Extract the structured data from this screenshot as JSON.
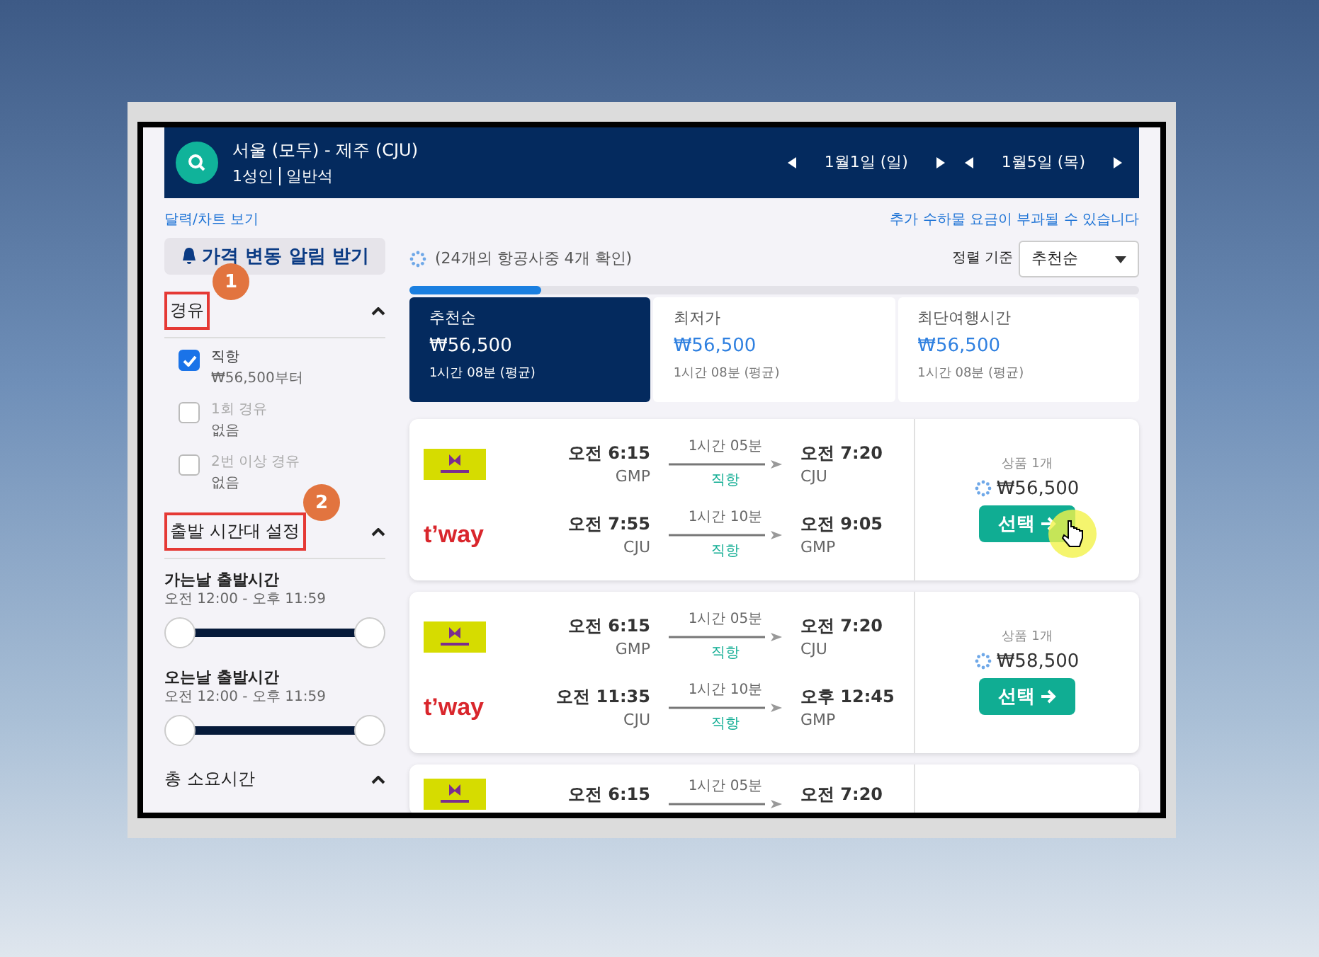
{
  "search": {
    "route": "서울 (모두) - 제주 (CJU)",
    "passengers": "1성인",
    "cabin": "일반석",
    "dates": [
      {
        "label": "1월1일 (일)"
      },
      {
        "label": "1월5일 (목)"
      }
    ]
  },
  "links": {
    "calendar": "달력/차트 보기",
    "fee_note": "추가 수하물 요금이 부과될 수 있습니다"
  },
  "alert_button": "가격 변동 알림 받기",
  "stops_filter": {
    "title": "경유",
    "annotation": "1",
    "expanded": true,
    "options": [
      {
        "label": "직항",
        "sub": "₩56,500부터",
        "checked": true,
        "disabled": false
      },
      {
        "label": "1회 경유",
        "sub": "없음",
        "checked": false,
        "disabled": true
      },
      {
        "label": "2번 이상 경유",
        "sub": "없음",
        "checked": false,
        "disabled": true
      }
    ]
  },
  "time_filter": {
    "title": "출발 시간대 설정",
    "annotation": "2",
    "expanded": true,
    "sliders": [
      {
        "label": "가는날 출발시간",
        "range": "오전 12:00 - 오후 11:59",
        "level": 1
      },
      {
        "label": "오는날 출발시간",
        "range": "오전 12:00 - 오후 11:59",
        "level": 1
      }
    ]
  },
  "duration_filter": {
    "title": "총 소요시간",
    "expanded": true
  },
  "status": "(24개의 항공사중 4개 확인)",
  "sort": {
    "label": "정렬 기준",
    "value": "추천순"
  },
  "progress": {
    "level": 0.18
  },
  "sort_tabs": [
    {
      "label": "추천순",
      "price": "₩56,500",
      "duration": "1시간 08분 (평균)",
      "selected": true
    },
    {
      "label": "최저가",
      "price": "₩56,500",
      "duration": "1시간 08분 (평균)",
      "selected": false
    },
    {
      "label": "최단여행시간",
      "price": "₩56,500",
      "duration": "1시간 08분 (평균)",
      "selected": false
    }
  ],
  "results": [
    {
      "legs": [
        {
          "kind": "jinair",
          "depart_time": "오전 6:15",
          "depart_airport": "GMP",
          "duration": "1시간 05분",
          "stops": "직항",
          "arrive_time": "오전 7:20",
          "arrive_airport": "CJU"
        },
        {
          "kind": "tway",
          "logo_text": "t’way",
          "depart_time": "오전 7:55",
          "depart_airport": "CJU",
          "duration": "1시간 10분",
          "stops": "직항",
          "arrive_time": "오전 9:05",
          "arrive_airport": "GMP"
        }
      ],
      "offers": "상품 1개",
      "price": "₩56,500",
      "button": "선택",
      "cursor": true
    },
    {
      "legs": [
        {
          "kind": "jinair",
          "depart_time": "오전 6:15",
          "depart_airport": "GMP",
          "duration": "1시간 05분",
          "stops": "직항",
          "arrive_time": "오전 7:20",
          "arrive_airport": "CJU"
        },
        {
          "kind": "tway",
          "logo_text": "t’way",
          "depart_time": "오전 11:35",
          "depart_airport": "CJU",
          "duration": "1시간 10분",
          "stops": "직항",
          "arrive_time": "오후 12:45",
          "arrive_airport": "GMP"
        }
      ],
      "offers": "상품 1개",
      "price": "₩58,500",
      "button": "선택",
      "cursor": false
    },
    {
      "legs": [
        {
          "kind": "jinair",
          "depart_time": "오전 6:15",
          "duration": "1시간 05분",
          "arrive_time": "오전 7:20"
        }
      ]
    }
  ]
}
